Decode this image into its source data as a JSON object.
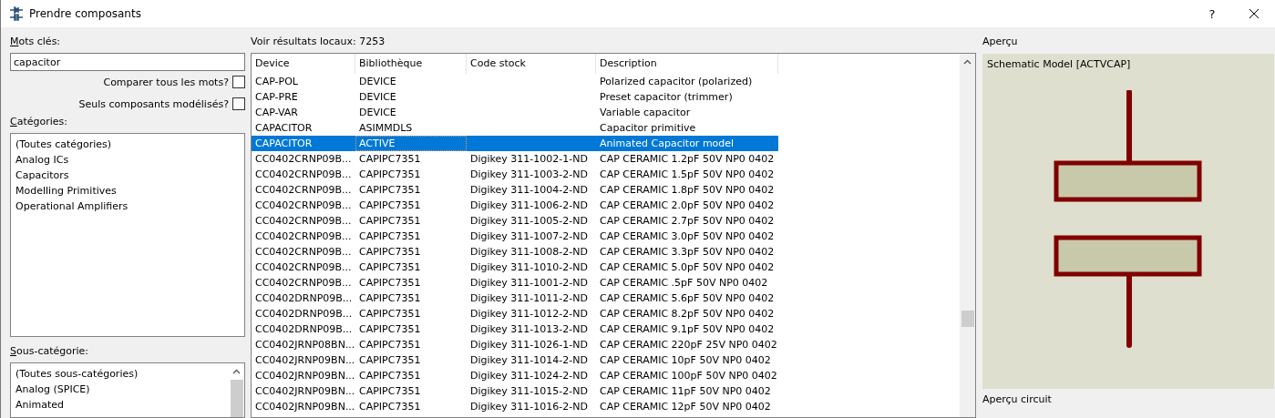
{
  "window": {
    "title": "Prendre composants",
    "help": "?"
  },
  "keywords": {
    "label": "Mots clés:",
    "value": "capacitor"
  },
  "options": [
    {
      "label": "Comparer tous les mots?",
      "checked": false
    },
    {
      "label": "Seuls composants modélisés?",
      "checked": false
    }
  ],
  "categories": {
    "label": "Catégories:",
    "items": [
      {
        "label": "(Toutes catégories)",
        "selected": false
      },
      {
        "label": "Analog ICs",
        "selected": false
      },
      {
        "label": "Capacitors",
        "selected": false
      },
      {
        "label": "Modelling Primitives",
        "selected": false
      },
      {
        "label": "Operational Amplifiers",
        "selected": false
      }
    ]
  },
  "subcategories": {
    "label": "Sous-catégorie:",
    "items": [
      {
        "label": "(Toutes sous-catégories)",
        "selected": false
      },
      {
        "label": "Analog (SPICE)",
        "selected": false
      },
      {
        "label": "Animated",
        "selected": false
      }
    ]
  },
  "results": {
    "label": "Voir résultats locaux: 7253",
    "columns": [
      "Device",
      "Bibliothèque",
      "Code stock",
      "Description"
    ],
    "rows": [
      {
        "cells": [
          "CAP-POL",
          "DEVICE",
          "",
          "Polarized capacitor (polarized)"
        ],
        "selected": false
      },
      {
        "cells": [
          "CAP-PRE",
          "DEVICE",
          "",
          "Preset capacitor (trimmer)"
        ],
        "selected": false
      },
      {
        "cells": [
          "CAP-VAR",
          "DEVICE",
          "",
          "Variable capacitor"
        ],
        "selected": false
      },
      {
        "cells": [
          "CAPACITOR",
          "ASIMMDLS",
          "",
          "Capacitor primitive"
        ],
        "selected": false
      },
      {
        "cells": [
          "CAPACITOR",
          "ACTIVE",
          "",
          "Animated Capacitor model"
        ],
        "selected": true
      },
      {
        "cells": [
          "CC0402CRNP09B...",
          "CAPIPC7351",
          "Digikey 311-1002-1-ND",
          "CAP CERAMIC 1.2pF 50V NP0 0402"
        ],
        "selected": false
      },
      {
        "cells": [
          "CC0402CRNP09B...",
          "CAPIPC7351",
          "Digikey 311-1003-2-ND",
          "CAP CERAMIC 1.5pF 50V NP0 0402"
        ],
        "selected": false
      },
      {
        "cells": [
          "CC0402CRNP09B...",
          "CAPIPC7351",
          "Digikey 311-1004-2-ND",
          "CAP CERAMIC 1.8pF 50V NP0 0402"
        ],
        "selected": false
      },
      {
        "cells": [
          "CC0402CRNP09B...",
          "CAPIPC7351",
          "Digikey 311-1006-2-ND",
          "CAP CERAMIC 2.0pF 50V NP0 0402"
        ],
        "selected": false
      },
      {
        "cells": [
          "CC0402CRNP09B...",
          "CAPIPC7351",
          "Digikey 311-1005-2-ND",
          "CAP CERAMIC 2.7pF 50V NP0 0402"
        ],
        "selected": false
      },
      {
        "cells": [
          "CC0402CRNP09B...",
          "CAPIPC7351",
          "Digikey 311-1007-2-ND",
          "CAP CERAMIC 3.0pF 50V NP0 0402"
        ],
        "selected": false
      },
      {
        "cells": [
          "CC0402CRNP09B...",
          "CAPIPC7351",
          "Digikey 311-1008-2-ND",
          "CAP CERAMIC 3.3pF 50V NP0 0402"
        ],
        "selected": false
      },
      {
        "cells": [
          "CC0402CRNP09B...",
          "CAPIPC7351",
          "Digikey 311-1010-2-ND",
          "CAP CERAMIC 5.0pF 50V NP0 0402"
        ],
        "selected": false
      },
      {
        "cells": [
          "CC0402CRNP09B...",
          "CAPIPC7351",
          "Digikey 311-1001-2-ND",
          "CAP CERAMIC .5pF 50V NP0 0402"
        ],
        "selected": false
      },
      {
        "cells": [
          "CC0402DRNP09B...",
          "CAPIPC7351",
          "Digikey 311-1011-2-ND",
          "CAP CERAMIC 5.6pF 50V NP0 0402"
        ],
        "selected": false
      },
      {
        "cells": [
          "CC0402DRNP09B...",
          "CAPIPC7351",
          "Digikey 311-1012-2-ND",
          "CAP CERAMIC 8.2pF 50V NP0 0402"
        ],
        "selected": false
      },
      {
        "cells": [
          "CC0402DRNP09B...",
          "CAPIPC7351",
          "Digikey 311-1013-2-ND",
          "CAP CERAMIC 9.1pF 50V NP0 0402"
        ],
        "selected": false
      },
      {
        "cells": [
          "CC0402JRNP08BN...",
          "CAPIPC7351",
          "Digikey 311-1026-1-ND",
          "CAP CERAMIC 220pF 25V NP0 0402"
        ],
        "selected": false
      },
      {
        "cells": [
          "CC0402JRNP09BN...",
          "CAPIPC7351",
          "Digikey 311-1014-2-ND",
          "CAP CERAMIC 10pF 50V NP0 0402"
        ],
        "selected": false
      },
      {
        "cells": [
          "CC0402JRNP09BN...",
          "CAPIPC7351",
          "Digikey 311-1024-2-ND",
          "CAP CERAMIC 100pF 50V NP0 0402"
        ],
        "selected": false
      },
      {
        "cells": [
          "CC0402JRNP09BN...",
          "CAPIPC7351",
          "Digikey 311-1015-2-ND",
          "CAP CERAMIC 11pF 50V NP0 0402"
        ],
        "selected": false
      },
      {
        "cells": [
          "CC0402JRNP09BN...",
          "CAPIPC7351",
          "Digikey 311-1016-2-ND",
          "CAP CERAMIC 12pF 50V NP0 0402"
        ],
        "selected": false
      }
    ]
  },
  "preview": {
    "label": "Aperçu",
    "caption": "Schematic Model [ACTVCAP]",
    "circuit_label": "Aperçu circuit"
  }
}
